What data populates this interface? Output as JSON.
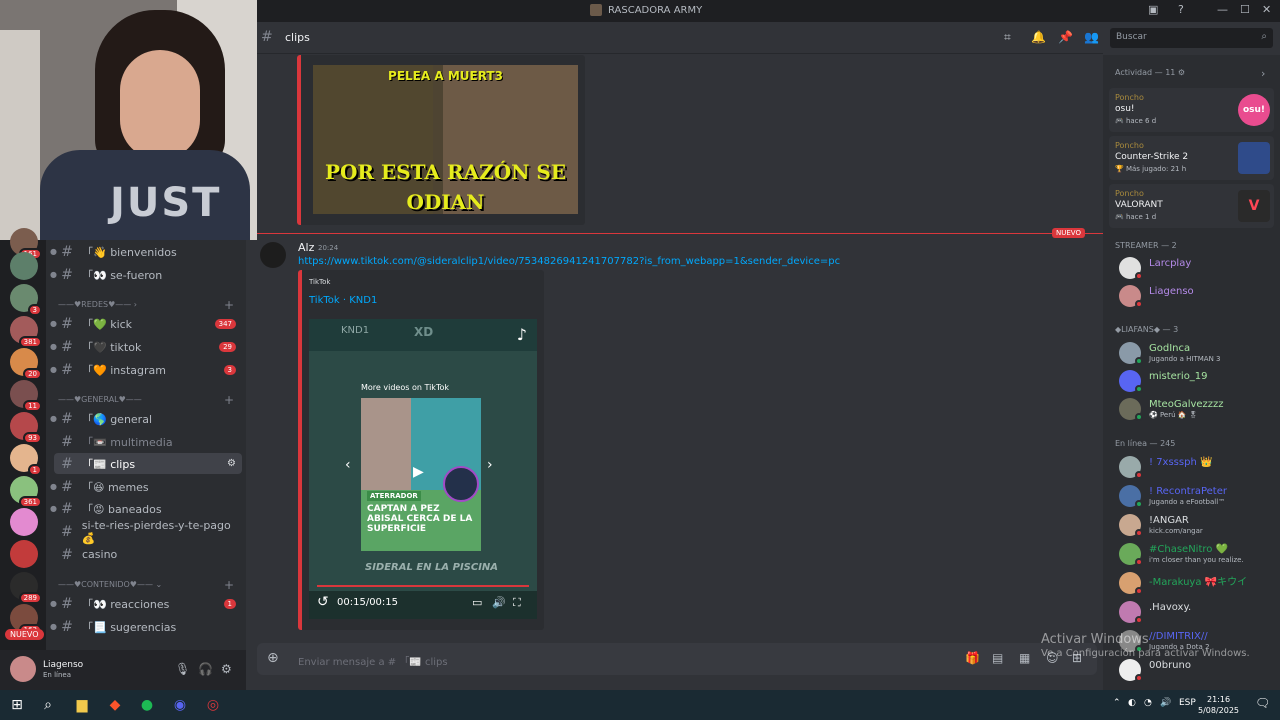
{
  "window": {
    "title": "RASCADORA ARMY"
  },
  "channel": {
    "name": "clips",
    "prefix": "「📰",
    "search_placeholder": "Buscar"
  },
  "server_rail": {
    "badges": [
      "161",
      "3",
      "381",
      "20",
      "11",
      "93",
      "1",
      "361",
      "289",
      "163"
    ],
    "nuevo": "NUEVO"
  },
  "channels": {
    "items": [
      {
        "name": "「👋 bienvenidos"
      },
      {
        "name": "「👀 se-fueron"
      },
      {
        "name": "「💚 kick",
        "count": "347"
      },
      {
        "name": "「🖤 tiktok",
        "count": "29"
      },
      {
        "name": "「🧡 instagram",
        "count": "3"
      },
      {
        "name": "「🌎 general"
      },
      {
        "name": "「📼 multimedia"
      },
      {
        "name": "「📰 clips"
      },
      {
        "name": "「😆 memes"
      },
      {
        "name": "「😡 baneados"
      },
      {
        "name": "si-te-ries-pierdes-y-te-pago💰"
      },
      {
        "name": "casino"
      },
      {
        "name": "「👀 reacciones",
        "count": "1"
      },
      {
        "name": "「📃 sugerencias"
      }
    ],
    "categories": [
      "——♥REDES♥—— ›",
      "——♥GENERAL♥——",
      "——♥CONTENIDO♥—— ⌄"
    ]
  },
  "user": {
    "name": "Liagenso",
    "status": "En línea"
  },
  "old_embed": {
    "top_text": "PELEA A MUERT3",
    "main_text": "POR ESTA RAZÓN SE ODIAN"
  },
  "new_marker": "NUEVO",
  "message": {
    "author": "Alz",
    "time": "20:24",
    "link": "https://www.tiktok.com/@sideralclip1/video/7534826941241707782?is_from_webapp=1&sender_device=pc",
    "embed": {
      "provider": "TikTok",
      "title": "TikTok · KND1",
      "video": {
        "channel": "KND1",
        "xd": "XD",
        "more": "More videos on TikTok",
        "tag": "ATERRADOR",
        "headline": "CAPTAN A PEZ ABISAL CERCA DE LA SUPERFICIE",
        "caption": "SIDERAL EN LA PISCINA",
        "time": "00:15/00:15"
      }
    }
  },
  "composer": {
    "placeholder": "Enviar mensaje a # 「📰 clips"
  },
  "members": {
    "activity_header": "Actividad — 11 ⚙",
    "activities": [
      {
        "who": "Poncho",
        "game": "osu!",
        "sub": "🎮 hace 6 d",
        "icon_color": "#e94c8f",
        "icon_text": "osu!"
      },
      {
        "who": "Poncho",
        "game": "Counter-Strike 2",
        "sub": "🏆 Más jugado: 21 h",
        "icon_color": "#2f4b8a",
        "icon_text": ""
      },
      {
        "who": "Poncho",
        "game": "VALORANT",
        "sub": "🎮 hace 1 d",
        "icon_color": "#2a2a2a",
        "icon_text": "V"
      }
    ],
    "streamer_header": "STREAMER — 2",
    "streamers": [
      {
        "name": "Larcplay",
        "color": "#b48ae8"
      },
      {
        "name": "Liagenso",
        "color": "#b48ae8"
      }
    ],
    "liafans_header": "◆LIAFANS◆ — 3",
    "liafans": [
      {
        "name": "GodInca",
        "sub": "Jugando a HITMAN 3",
        "color": "#dbdee1",
        "status": "on"
      },
      {
        "name": "misterio_19",
        "sub": "",
        "color": "#dbdee1",
        "status": "on"
      },
      {
        "name": "MteoGalvezzzz",
        "sub": "⚽ Perú 🏠 🎖",
        "color": "#dbdee1",
        "status": "on"
      }
    ],
    "online_header": "En línea — 245",
    "online": [
      {
        "name": "! 7xsssph 👑",
        "sub": "",
        "color": "#5865f2"
      },
      {
        "name": "! RecontraPeter",
        "sub": "Jugando a eFootball™",
        "color": "#5865f2"
      },
      {
        "name": "!ANGAR",
        "sub": "kick.com/angar",
        "color": "#dbdee1"
      },
      {
        "name": "#ChaseNitro 💚",
        "sub": "i'm closer than you realize.",
        "color": "#23a55a"
      },
      {
        "name": "-Marakuya 🎀キウイ",
        "sub": "",
        "color": "#23a55a"
      },
      {
        "name": ".Havoxy.",
        "sub": "",
        "color": "#dbdee1"
      },
      {
        "name": "//DIMITRIX//",
        "sub": "Jugando a Dota 2",
        "color": "#5865f2"
      },
      {
        "name": "00bruno",
        "sub": "",
        "color": "#dbdee1"
      }
    ]
  },
  "watermark": {
    "line1": "Activar Windows",
    "line2": "Ve a Configuración para activar Windows."
  },
  "taskbar": {
    "lang": "ESP",
    "time": "21:16",
    "date": "5/08/2025"
  }
}
